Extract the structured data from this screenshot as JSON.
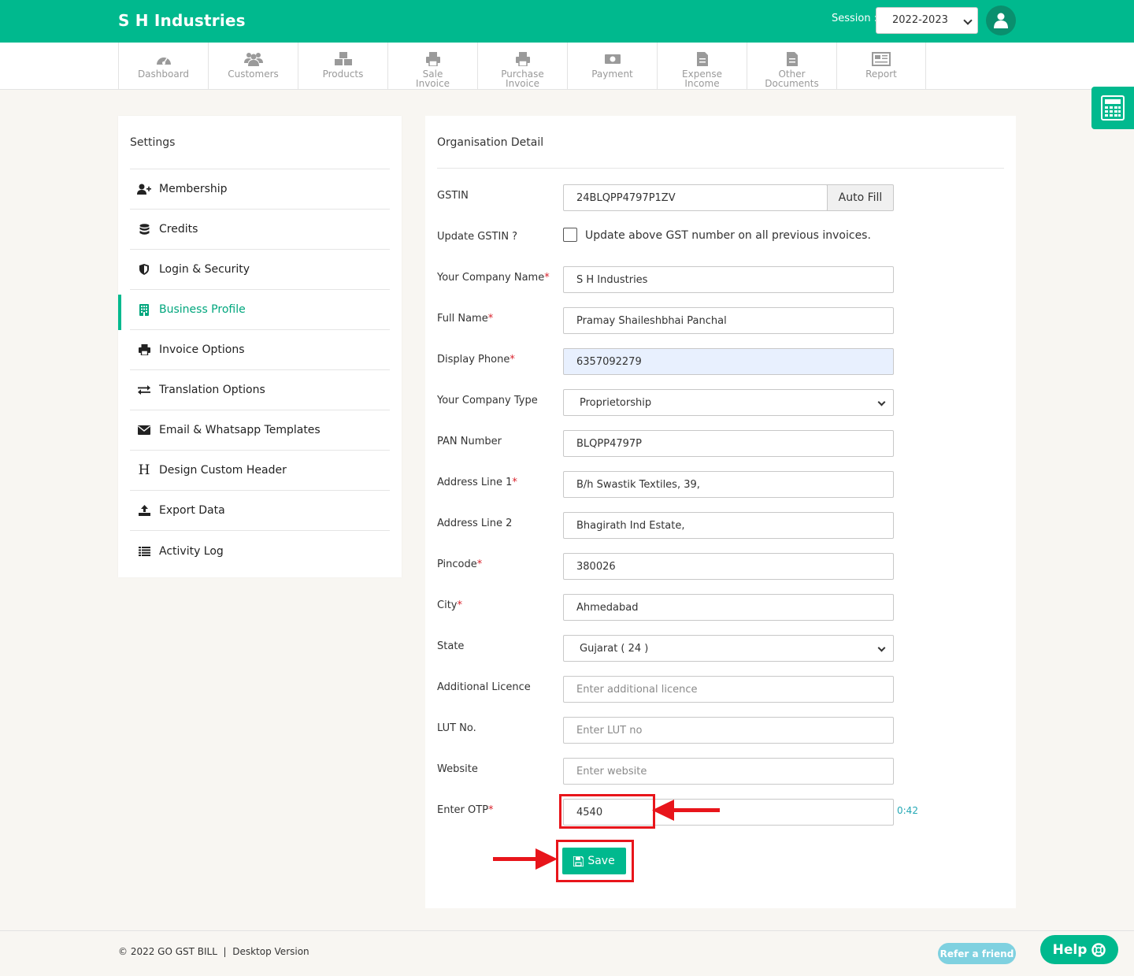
{
  "header": {
    "brand": "S H Industries",
    "session_label": "Session :",
    "session_value": "2022-2023"
  },
  "nav": [
    {
      "label": "Dashboard",
      "icon": "dashboard-icon"
    },
    {
      "label": "Customers",
      "icon": "customers-icon"
    },
    {
      "label": "Products",
      "icon": "products-icon"
    },
    {
      "label": "Sale\nInvoice",
      "icon": "printer-icon"
    },
    {
      "label": "Purchase\nInvoice",
      "icon": "printer-icon"
    },
    {
      "label": "Payment",
      "icon": "money-icon"
    },
    {
      "label": "Expense\nIncome",
      "icon": "document-icon"
    },
    {
      "label": "Other\nDocuments",
      "icon": "documents-icon"
    },
    {
      "label": "Report",
      "icon": "report-icon"
    }
  ],
  "settings": {
    "title": "Settings",
    "items": [
      {
        "label": "Membership",
        "icon": "user-plus-icon"
      },
      {
        "label": "Credits",
        "icon": "database-icon"
      },
      {
        "label": "Login & Security",
        "icon": "shield-icon"
      },
      {
        "label": "Business Profile",
        "icon": "building-icon",
        "active": true
      },
      {
        "label": "Invoice Options",
        "icon": "printer-icon"
      },
      {
        "label": "Translation Options",
        "icon": "exchange-icon"
      },
      {
        "label": "Email & Whatsapp Templates",
        "icon": "envelope-icon"
      },
      {
        "label": "Design Custom Header",
        "icon": "heading-icon"
      },
      {
        "label": "Export Data",
        "icon": "upload-icon"
      },
      {
        "label": "Activity Log",
        "icon": "list-icon"
      }
    ]
  },
  "form": {
    "title": "Organisation Detail",
    "gstin_label": "GSTIN",
    "gstin_value": "24BLQPP4797P1ZV",
    "autofill_label": "Auto Fill",
    "update_gstin_label": "Update GSTIN ?",
    "update_gstin_text": "Update above GST number on all previous invoices.",
    "company_name_label": "Your Company Name",
    "company_name_value": "S H Industries",
    "full_name_label": "Full Name",
    "full_name_value": "Pramay Shaileshbhai Panchal",
    "phone_label": "Display Phone",
    "phone_value": "6357092279",
    "company_type_label": "Your Company Type",
    "company_type_value": "Proprietorship",
    "pan_label": "PAN Number",
    "pan_value": "BLQPP4797P",
    "address1_label": "Address Line 1",
    "address1_value": "B/h Swastik Textiles, 39,",
    "address2_label": "Address Line 2",
    "address2_value": "Bhagirath Ind Estate,",
    "pincode_label": "Pincode",
    "pincode_value": "380026",
    "city_label": "City",
    "city_value": "Ahmedabad",
    "state_label": "State",
    "state_value": "Gujarat ( 24 )",
    "licence_label": "Additional Licence",
    "licence_placeholder": "Enter additional licence",
    "lut_label": "LUT No.",
    "lut_placeholder": "Enter LUT no",
    "website_label": "Website",
    "website_placeholder": "Enter website",
    "otp_label": "Enter OTP",
    "otp_value": "4540",
    "otp_timer": "0:42",
    "save_label": "Save",
    "required_mark": "*"
  },
  "footer": {
    "copyright": "© 2022 GO GST BILL  |  Desktop Version",
    "refer_label": "Refer a friend",
    "help_label": "Help"
  },
  "colors": {
    "brand": "#00b98e",
    "highlight": "#e8151b",
    "required": "#d9232d"
  }
}
